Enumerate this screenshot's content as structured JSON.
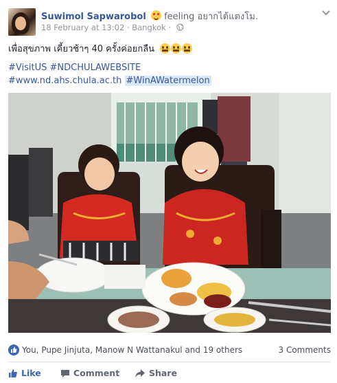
{
  "post": {
    "author": "Suwimol Sapwarobol",
    "feeling_prefix": "feeling",
    "feeling_value": "อยากได้แตงโม.",
    "timestamp": "18 February at 13:02",
    "separator": "·",
    "location": "Bangkok",
    "separator2": "·",
    "text_line1": "เพื่อสุขภาพ เคี้ยวช้าๆ 40 ครั้งค่อยกลืน",
    "hashtags_line": "#VisitUS #NDCHULAWEBSITE",
    "url": "#www.nd.ahs.chula.ac.th",
    "highlight_tag": "#WinAWatermelon",
    "emoji_icon": "weary-face-icon",
    "feeling_icon": "star-struck-face-icon",
    "audience_icon": "globe-icon"
  },
  "engagement": {
    "likers": "You, Pupe Jinjuta, Manow N Wattanakul and 19 others",
    "comments": "3 Comments"
  },
  "actions": {
    "like": "Like",
    "comment": "Comment",
    "share": "Share"
  },
  "colors": {
    "link": "#365899",
    "like_blue": "#4267b2",
    "meta_gray": "#90949c",
    "highlight_bg": "#dbe7fb"
  }
}
